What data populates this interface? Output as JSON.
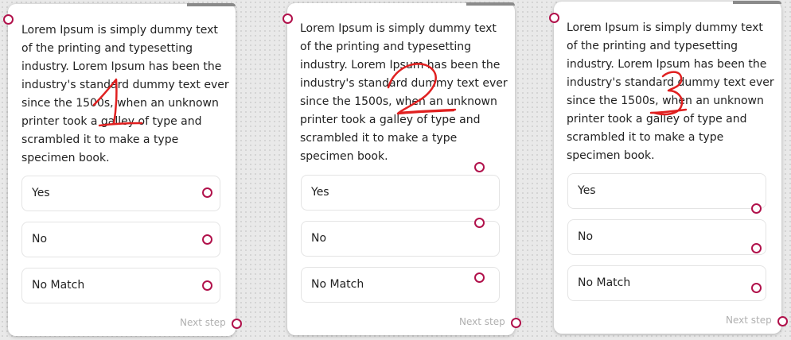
{
  "description": "Lorem Ipsum is simply dummy text of the printing and typesetting industry. Lorem Ipsum has been the industry's standard dummy text ever since the 1500s, when an unknown printer took a galley of type and scrambled it to make a type specimen book.",
  "options": {
    "yes": "Yes",
    "no": "No",
    "no_match": "No Match"
  },
  "next_step": "Next step",
  "annotations": [
    "1",
    "2",
    "3"
  ],
  "colors": {
    "port": "#b1114b",
    "annotation": "#e02020"
  }
}
